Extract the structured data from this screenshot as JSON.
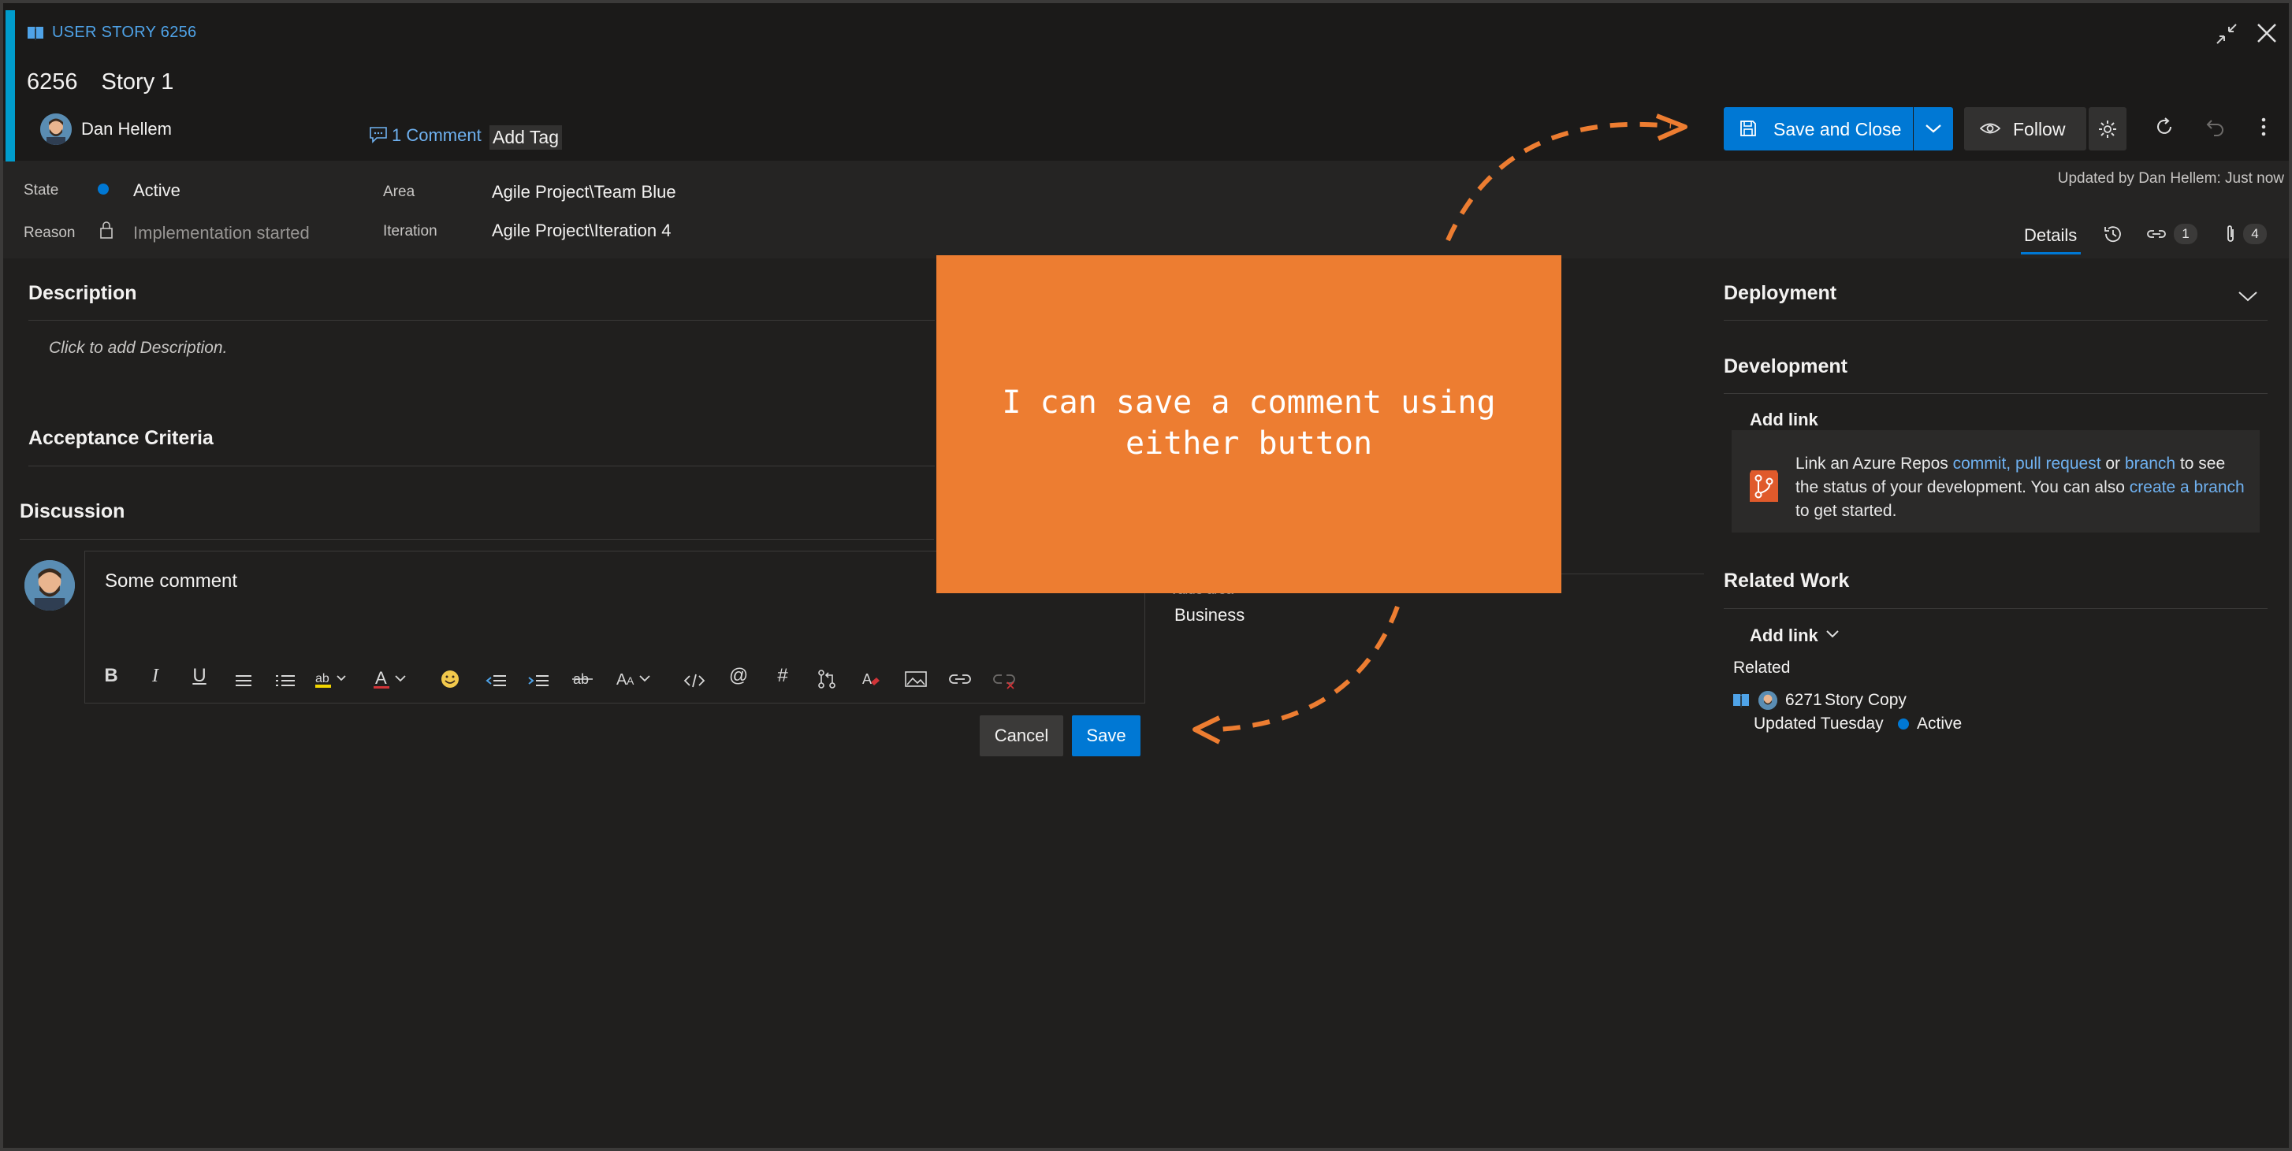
{
  "header": {
    "type_label": "USER STORY 6256",
    "id": "6256",
    "title": "Story 1",
    "author": "Dan Hellem",
    "comment_link": "1 Comment",
    "add_tag": "Add Tag",
    "updated_by": "Updated by Dan Hellem: Just now"
  },
  "toolbar": {
    "save_and_close": "Save and Close",
    "follow": "Follow"
  },
  "fields": {
    "state_label": "State",
    "state_value": "Active",
    "reason_label": "Reason",
    "reason_value": "Implementation started",
    "area_label": "Area",
    "area_value": "Agile Project\\Team Blue",
    "iteration_label": "Iteration",
    "iteration_value": "Agile Project\\Iteration 4"
  },
  "tabs": {
    "details": "Details",
    "links_count": "1",
    "attachments_count": "4"
  },
  "left": {
    "description_title": "Description",
    "description_placeholder": "Click to add Description.",
    "acceptance_title": "Acceptance Criteria",
    "discussion_title": "Discussion",
    "comment_text": "Some comment",
    "cancel": "Cancel",
    "save": "Save"
  },
  "middle": {
    "value_area_label": "Value area",
    "value_area_value": "Business"
  },
  "right": {
    "deployment_title": "Deployment",
    "development_title": "Development",
    "dev_add_link": "Add link",
    "dev_text_1": "Link an Azure Repos ",
    "dev_link_commit": "commit",
    "dev_link_pr": "pull request",
    "dev_text_or": " or ",
    "dev_link_branch": "branch",
    "dev_text_2": " to see the status of your development. You can also ",
    "dev_link_create_branch": "create a branch",
    "dev_text_3": " to get started.",
    "related_work_title": "Related Work",
    "rw_add_link": "Add link",
    "related_label": "Related",
    "related_item_id": "6271",
    "related_item_title": "Story Copy",
    "related_item_updated": "Updated Tuesday",
    "related_item_state": "Active"
  },
  "overlay": {
    "text": "I can save a comment using either button"
  },
  "colors": {
    "accent": "#009ccc",
    "primary": "#0078d4",
    "overlay_orange": "#ed7d31"
  }
}
